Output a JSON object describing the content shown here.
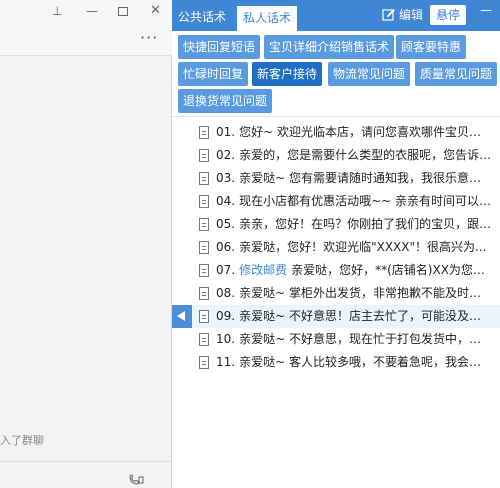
{
  "left": {
    "window_controls": {
      "pin": "⊥",
      "minimize": "—",
      "close": "✕"
    },
    "more": "···",
    "join_hint": "入了群聊"
  },
  "header": {
    "tabs": [
      {
        "label": "公共话术"
      },
      {
        "label": "私人话术"
      }
    ],
    "edit_label": "编辑",
    "hover_label": "悬停",
    "minimize": "—"
  },
  "categories": [
    {
      "label": "快捷回复短语"
    },
    {
      "label": "宝贝详细介绍销售话术"
    },
    {
      "label": "顾客要特惠"
    },
    {
      "label": "忙碌时回复"
    },
    {
      "label": "新客户接待"
    },
    {
      "label": "物流常见问题"
    },
    {
      "label": "质量常见问题"
    },
    {
      "label": "退换货常见问题"
    }
  ],
  "active_category": "新客户接待",
  "replies": [
    {
      "num": "01.",
      "link": "",
      "text": "您好~ 欢迎光临本店，请问您喜欢哪件宝贝？我..."
    },
    {
      "num": "02.",
      "link": "",
      "text": "亲爱的，您是需要什么类型的衣服呢，您告诉我..."
    },
    {
      "num": "03.",
      "link": "",
      "text": "亲爱哒~ 您有需要请随时通知我，我很乐意为你..."
    },
    {
      "num": "04.",
      "link": "",
      "text": "现在小店都有优惠活动哦~~ 亲亲有时间可以了..."
    },
    {
      "num": "05.",
      "link": "",
      "text": "亲亲，您好！在吗？你刚拍了我们的宝贝，跟您..."
    },
    {
      "num": "06.",
      "link": "",
      "text": "亲爱哒，您好！欢迎光临\"XXXX\"！很高兴为..."
    },
    {
      "num": "07.",
      "link": "修改邮费",
      "text": "亲爱哒，您好，**(店铺名)XX为您服..."
    },
    {
      "num": "08.",
      "link": "",
      "text": "亲爱哒~ 掌柜外出发货，非常抱歉不能及时回复..."
    },
    {
      "num": "09.",
      "link": "",
      "text": "亲爱哒~ 不好意思！店主去忙了，可能没及时的..."
    },
    {
      "num": "10.",
      "link": "",
      "text": "亲爱哒~ 不好意思，现在忙于打包发货中，有事..."
    },
    {
      "num": "11.",
      "link": "",
      "text": "亲爱哒~ 客人比较多哦，不要着急呢，我会一个..."
    }
  ],
  "selected_reply": "09.",
  "colors": {
    "accent": "#3f86d5",
    "category_bg": "#5a9be0",
    "category_active": "#1e6fc5",
    "link": "#3a88d6"
  }
}
